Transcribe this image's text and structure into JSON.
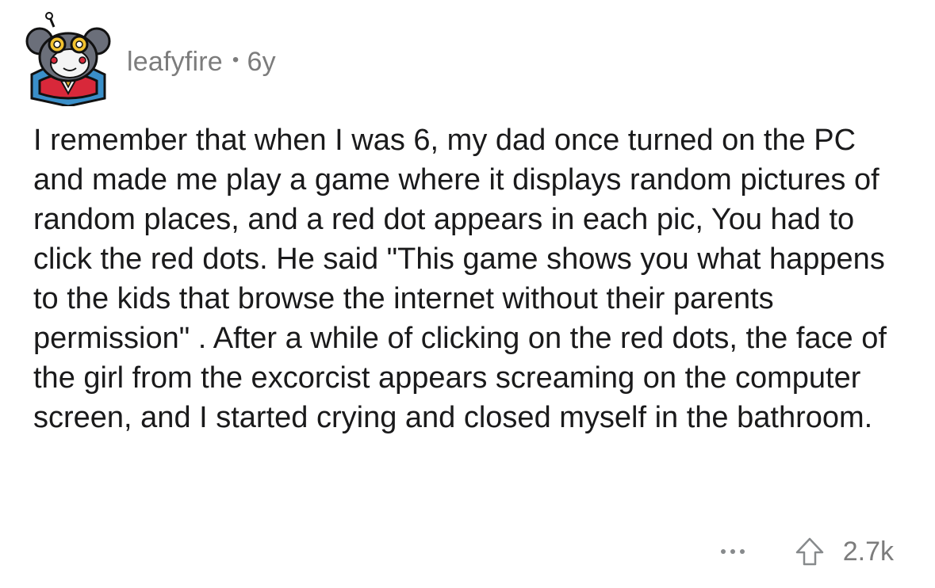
{
  "comment": {
    "username": "leafyfire",
    "separator": "•",
    "age": "6y",
    "body": "I remember that when I was 6, my dad once turned on the PC and made me play a game where it displays random pictures of random places, and a red dot appears in each pic, You had to click the red dots. He said \"This game shows you what happens to the kids that browse the internet without their parents permission\" . After a while of clicking on the red dots, the face of the girl from the excorcist appears screaming on the computer screen, and I started crying and closed myself in the bathroom.",
    "score": "2.7k",
    "avatar_icon": "snoo-avatar-icon",
    "more_icon": "more-options-icon",
    "upvote_icon": "upvote-arrow-icon"
  },
  "colors": {
    "text": "#1a1a1b",
    "meta": "#7c7c7c",
    "icon_gray": "#878a8c",
    "avatar_blue": "#3a8fc9",
    "avatar_red": "#d8283a"
  }
}
